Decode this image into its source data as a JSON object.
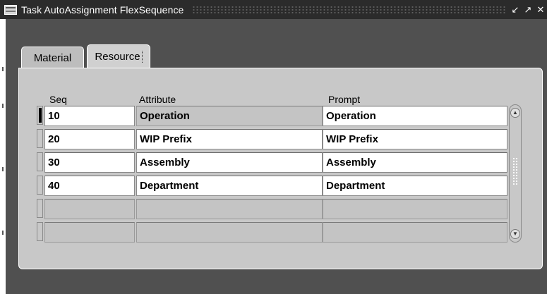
{
  "window": {
    "title": "Task AutoAssignment FlexSequence",
    "icon": "oracle-forms-icon",
    "controls": [
      "minimize-icon",
      "maximize-icon",
      "close-icon"
    ]
  },
  "tabs": [
    {
      "label": "Material",
      "selected": false
    },
    {
      "label": "Resource",
      "selected": true
    }
  ],
  "columns": {
    "seq": "Seq",
    "attribute": "Attribute",
    "prompt": "Prompt"
  },
  "rows": [
    {
      "seq": "10",
      "attribute": "Operation",
      "prompt": "Operation",
      "current": true
    },
    {
      "seq": "20",
      "attribute": "WIP Prefix",
      "prompt": "WIP Prefix",
      "current": false
    },
    {
      "seq": "30",
      "attribute": "Assembly",
      "prompt": "Assembly",
      "current": false
    },
    {
      "seq": "40",
      "attribute": "Department",
      "prompt": "Department",
      "current": false
    },
    {
      "seq": "",
      "attribute": "",
      "prompt": "",
      "current": false
    },
    {
      "seq": "",
      "attribute": "",
      "prompt": "",
      "current": false
    }
  ],
  "colors": {
    "titlebar": "#2b2b2b",
    "panel": "#c8c8c8",
    "field": "#ffffff"
  }
}
